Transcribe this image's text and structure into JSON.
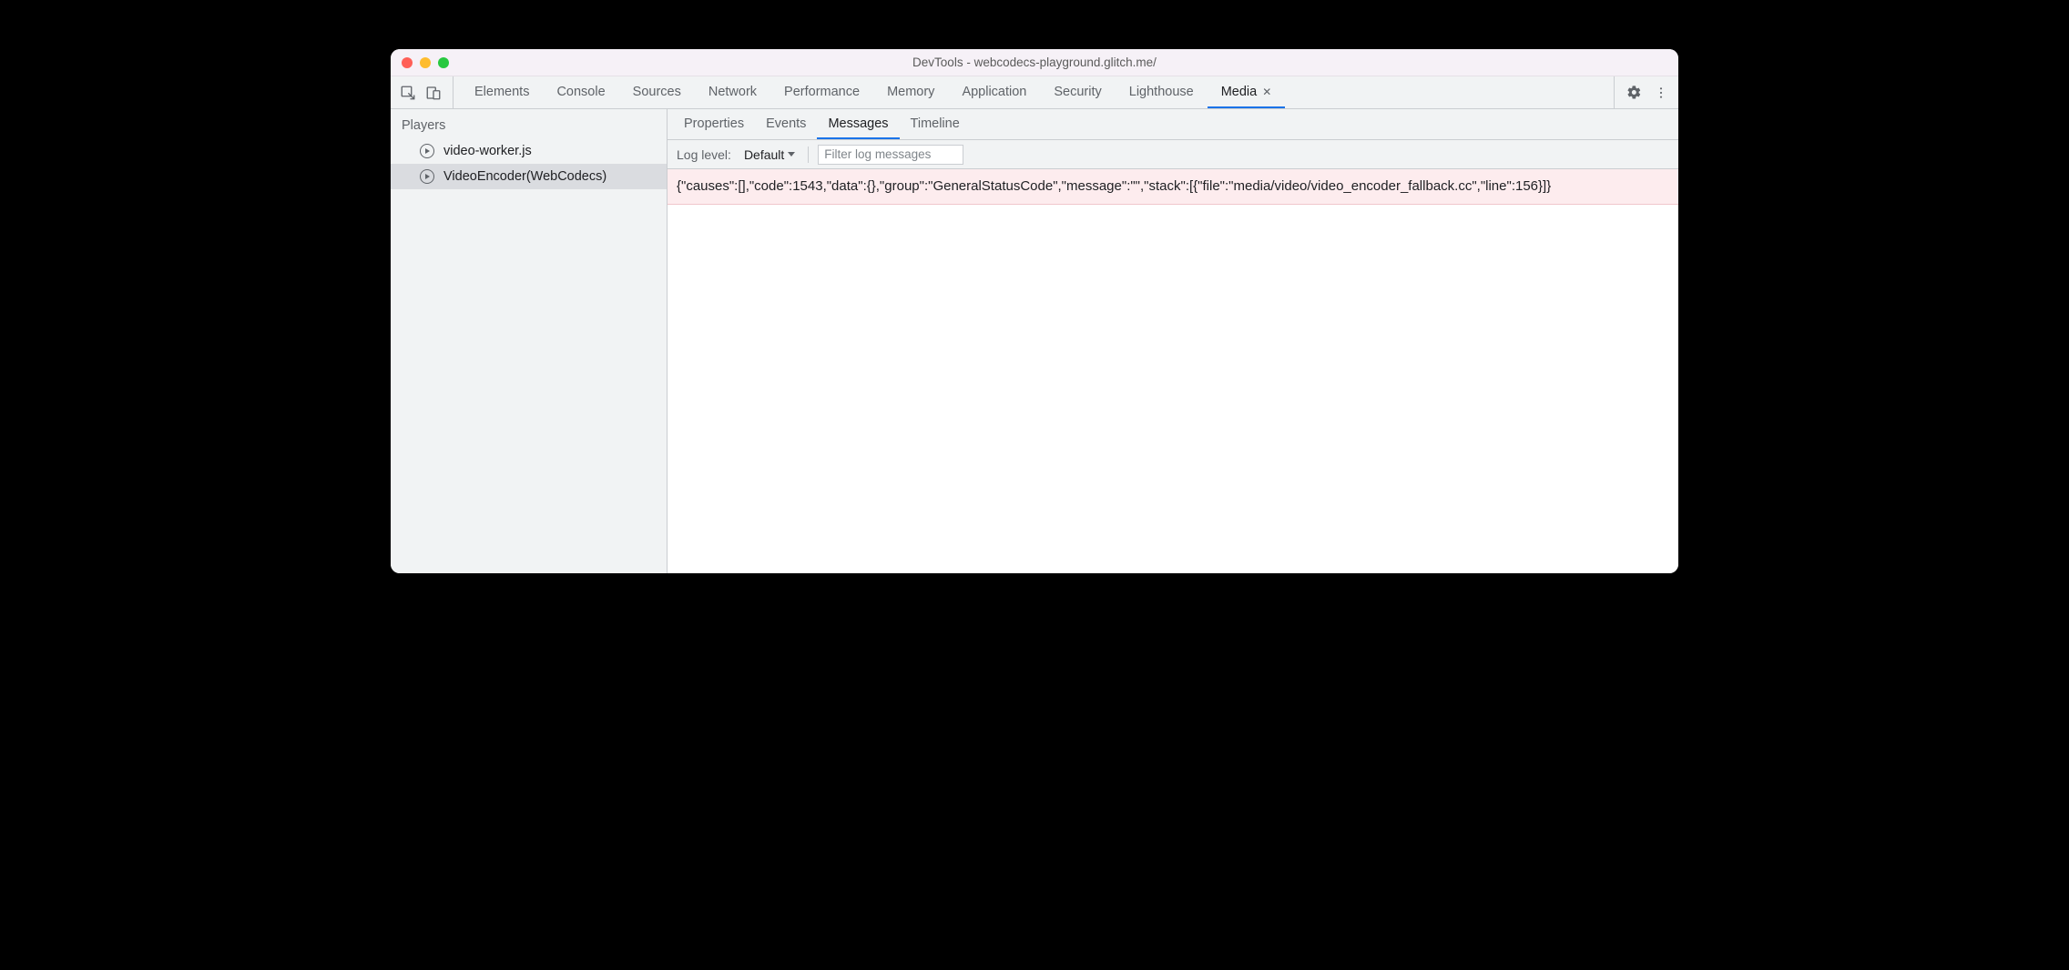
{
  "window": {
    "title": "DevTools - webcodecs-playground.glitch.me/"
  },
  "tabs": [
    {
      "label": "Elements",
      "active": false,
      "name": "tab-elements"
    },
    {
      "label": "Console",
      "active": false,
      "name": "tab-console"
    },
    {
      "label": "Sources",
      "active": false,
      "name": "tab-sources"
    },
    {
      "label": "Network",
      "active": false,
      "name": "tab-network"
    },
    {
      "label": "Performance",
      "active": false,
      "name": "tab-performance"
    },
    {
      "label": "Memory",
      "active": false,
      "name": "tab-memory"
    },
    {
      "label": "Application",
      "active": false,
      "name": "tab-application"
    },
    {
      "label": "Security",
      "active": false,
      "name": "tab-security"
    },
    {
      "label": "Lighthouse",
      "active": false,
      "name": "tab-lighthouse"
    },
    {
      "label": "Media",
      "active": true,
      "name": "tab-media",
      "closable": true
    }
  ],
  "sidebar": {
    "title": "Players",
    "items": [
      {
        "label": "video-worker.js",
        "selected": false,
        "name": "player-video-worker"
      },
      {
        "label": "VideoEncoder(WebCodecs)",
        "selected": true,
        "name": "player-video-encoder"
      }
    ]
  },
  "subtabs": [
    {
      "label": "Properties",
      "active": false,
      "name": "subtab-properties"
    },
    {
      "label": "Events",
      "active": false,
      "name": "subtab-events"
    },
    {
      "label": "Messages",
      "active": true,
      "name": "subtab-messages"
    },
    {
      "label": "Timeline",
      "active": false,
      "name": "subtab-timeline"
    }
  ],
  "toolbar": {
    "log_level_label": "Log level:",
    "log_level_value": "Default",
    "filter_placeholder": "Filter log messages"
  },
  "messages": [
    {
      "text": "{\"causes\":[],\"code\":1543,\"data\":{},\"group\":\"GeneralStatusCode\",\"message\":\"\",\"stack\":[{\"file\":\"media/video/video_encoder_fallback.cc\",\"line\":156}]}",
      "level": "error"
    }
  ]
}
